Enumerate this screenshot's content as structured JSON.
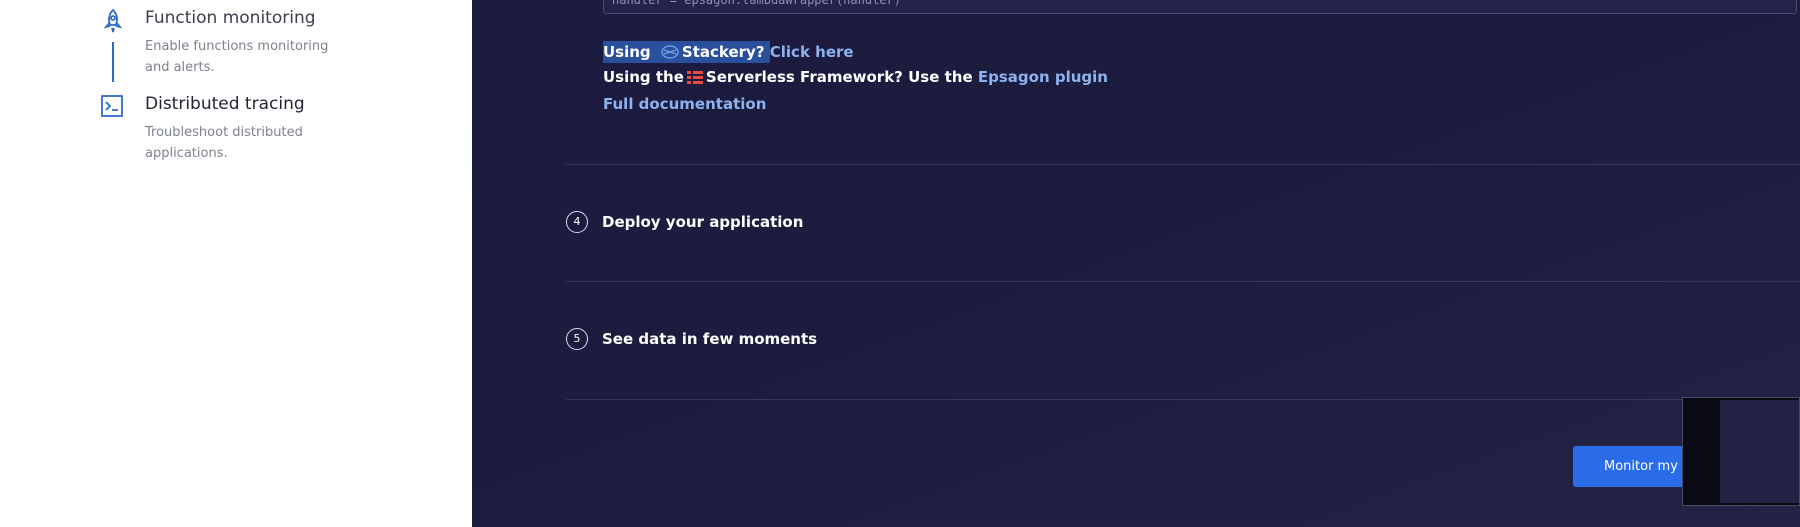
{
  "sidebar": {
    "items": [
      {
        "title": "Function monitoring",
        "desc_line1": "Enable functions monitoring",
        "desc_line2": "and alerts."
      },
      {
        "title": "Distributed tracing",
        "desc_line1": "Troubleshoot distributed",
        "desc_line2": "applications."
      }
    ]
  },
  "main": {
    "code_snippet": "handler = epsagon.lambdaWrapper(handler)",
    "stackery": {
      "prefix": "Using",
      "name": "Stackery?",
      "link": "Click here"
    },
    "serverless": {
      "prefix": "Using the",
      "text": "Serverless Framework? Use the",
      "link": "Epsagon plugin"
    },
    "docs_link": "Full documentation",
    "steps": [
      {
        "num": "4",
        "label": "Deploy your application"
      },
      {
        "num": "5",
        "label": "See data in few moments"
      }
    ],
    "monitor_button": "Monitor my"
  },
  "colors": {
    "accent": "#2b6ce8",
    "panel": "#1c1b40",
    "link": "#8fb2ee"
  }
}
